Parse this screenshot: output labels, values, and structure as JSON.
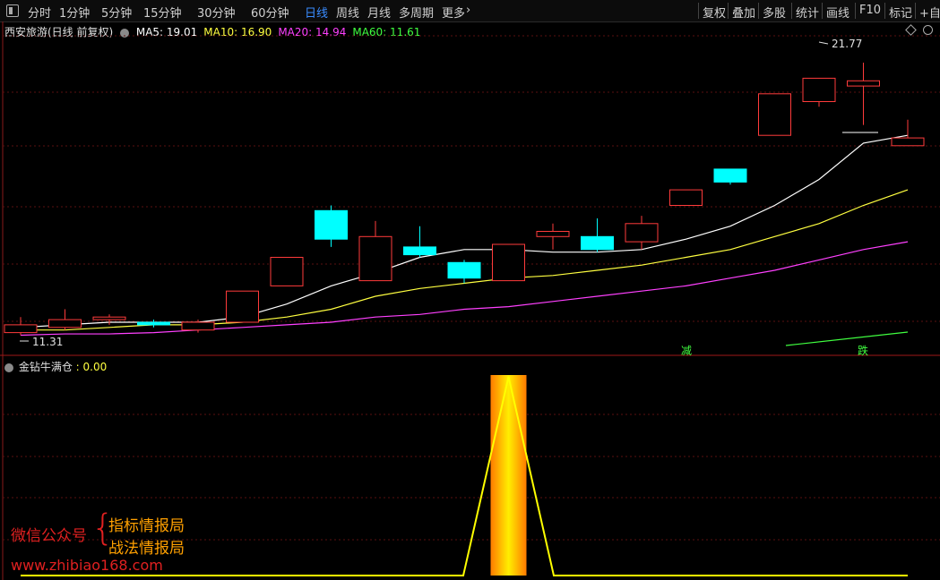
{
  "toolbar": {
    "periods": [
      "分时",
      "1分钟",
      "5分钟",
      "15分钟",
      "30分钟",
      "60分钟",
      "日线",
      "周线",
      "月线",
      "多周期",
      "更多"
    ],
    "active_period": "日线",
    "right_tools": [
      "复权",
      "叠加",
      "多股",
      "统计",
      "画线",
      "F10",
      "标记",
      "+自选"
    ]
  },
  "main_panel": {
    "title": "西安旅游(日线 前复权)",
    "ma": [
      {
        "label": "MA5: 19.01",
        "color": "#ffffff"
      },
      {
        "label": "MA10: 16.90",
        "color": "#ffff40"
      },
      {
        "label": "MA20: 14.94",
        "color": "#ff40ff"
      },
      {
        "label": "MA60: 11.61",
        "color": "#40ff40"
      }
    ],
    "high_label": "21.77",
    "low_label": "11.31",
    "markers": [
      "减",
      "跌"
    ]
  },
  "sub_panel": {
    "title": "金钻牛满仓",
    "value": ": 0.00"
  },
  "watermark": {
    "left": "微信公众号",
    "brace": "{",
    "line1": "指标情报局",
    "line2": "战法情报局",
    "url": "www.zhibiao168.com"
  },
  "colors": {
    "up": "#ff3b3b",
    "down": "#00ffff",
    "ma5": "#ffffff",
    "ma10": "#ffff40",
    "ma20": "#ff40ff",
    "ma60": "#40ff40",
    "indicator": "#ffff00"
  },
  "chart_data": {
    "type": "candlestick",
    "candles": [
      {
        "open": 11.4,
        "high": 12.0,
        "low": 11.3,
        "close": 11.7
      },
      {
        "open": 11.6,
        "high": 12.3,
        "low": 11.5,
        "close": 11.9
      },
      {
        "open": 11.9,
        "high": 12.1,
        "low": 11.7,
        "close": 12.0
      },
      {
        "open": 11.8,
        "high": 11.9,
        "low": 11.6,
        "close": 11.7
      },
      {
        "open": 11.5,
        "high": 11.9,
        "low": 11.4,
        "close": 11.8
      },
      {
        "open": 11.8,
        "high": 13.0,
        "low": 11.8,
        "close": 13.0
      },
      {
        "open": 13.2,
        "high": 14.3,
        "low": 13.2,
        "close": 14.3
      },
      {
        "open": 16.1,
        "high": 16.3,
        "low": 14.7,
        "close": 15.0
      },
      {
        "open": 13.4,
        "high": 15.7,
        "low": 13.4,
        "close": 15.1
      },
      {
        "open": 14.7,
        "high": 15.5,
        "low": 14.3,
        "close": 14.4
      },
      {
        "open": 14.1,
        "high": 14.2,
        "low": 13.3,
        "close": 13.5
      },
      {
        "open": 13.4,
        "high": 14.8,
        "low": 13.4,
        "close": 14.8
      },
      {
        "open": 15.1,
        "high": 15.6,
        "low": 14.6,
        "close": 15.3
      },
      {
        "open": 15.1,
        "high": 15.8,
        "low": 14.5,
        "close": 14.6
      },
      {
        "open": 14.9,
        "high": 15.9,
        "low": 14.6,
        "close": 15.6
      },
      {
        "open": 16.3,
        "high": 16.9,
        "low": 16.3,
        "close": 16.9
      },
      {
        "open": 17.7,
        "high": 17.7,
        "low": 17.1,
        "close": 17.2
      },
      {
        "open": 19.0,
        "high": 20.6,
        "low": 19.0,
        "close": 20.6
      },
      {
        "open": 20.3,
        "high": 21.2,
        "low": 20.1,
        "close": 21.2
      },
      {
        "open": 20.9,
        "high": 21.8,
        "low": 19.4,
        "close": 21.1
      },
      {
        "open": 18.6,
        "high": 19.6,
        "low": 18.6,
        "close": 18.9
      }
    ],
    "ma5": [
      11.6,
      11.7,
      11.8,
      11.8,
      11.8,
      12.0,
      12.5,
      13.2,
      13.7,
      14.3,
      14.6,
      14.6,
      14.5,
      14.5,
      14.6,
      15.0,
      15.5,
      16.3,
      17.3,
      18.7,
      19.0
    ],
    "ma10": [
      11.5,
      11.5,
      11.6,
      11.7,
      11.7,
      11.8,
      12.0,
      12.3,
      12.8,
      13.1,
      13.3,
      13.5,
      13.6,
      13.8,
      14.0,
      14.3,
      14.6,
      15.1,
      15.6,
      16.3,
      16.9
    ],
    "ma20": [
      11.3,
      11.35,
      11.35,
      11.4,
      11.5,
      11.6,
      11.7,
      11.8,
      12.0,
      12.1,
      12.3,
      12.4,
      12.6,
      12.8,
      13.0,
      13.2,
      13.5,
      13.8,
      14.2,
      14.6,
      14.9
    ],
    "ma60_segment": [
      10.8,
      11.2
    ],
    "indicator": [
      0,
      0,
      0,
      0,
      0,
      0,
      0,
      0,
      0,
      0,
      0,
      1,
      0,
      0,
      0,
      0,
      0,
      0,
      0,
      0,
      0
    ]
  }
}
